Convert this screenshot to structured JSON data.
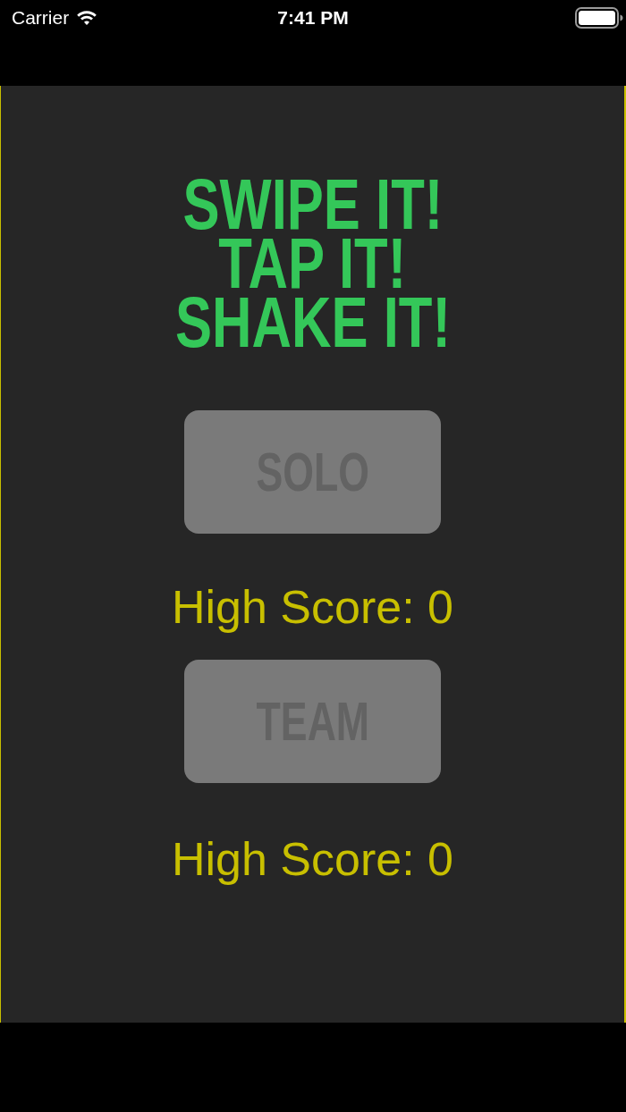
{
  "status_bar": {
    "carrier": "Carrier",
    "time": "7:41 PM"
  },
  "title_lines": [
    "SWIPE IT!",
    "TAP IT!",
    "SHAKE IT!"
  ],
  "modes": [
    {
      "label": "SOLO",
      "disabled": true,
      "high_score": "High Score: 0"
    },
    {
      "label": "TEAM",
      "disabled": true,
      "high_score": "High Score: 0"
    }
  ]
}
